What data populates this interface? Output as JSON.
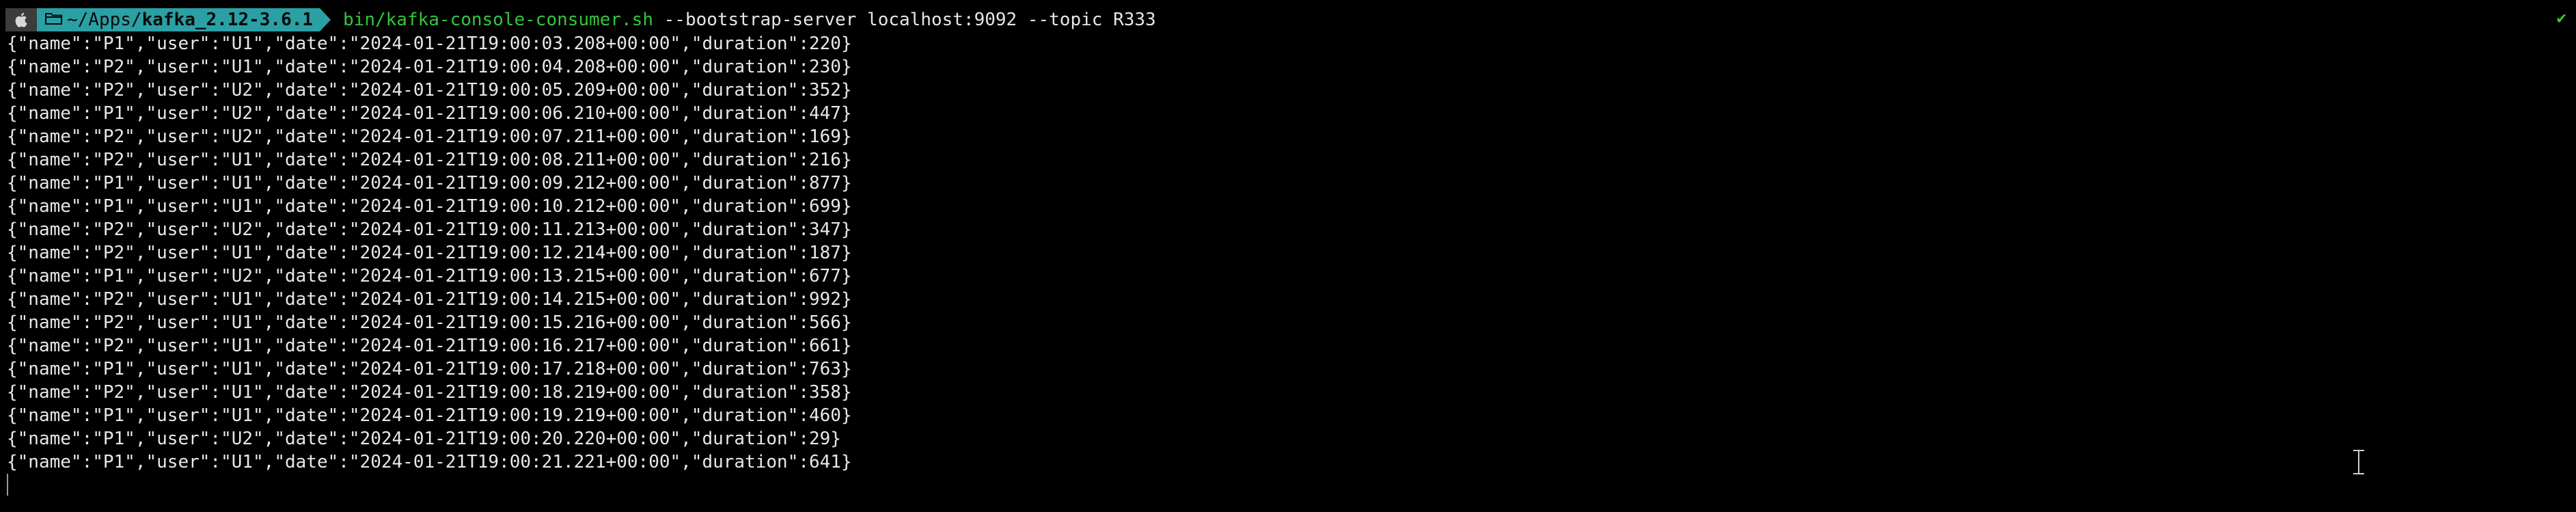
{
  "prompt": {
    "os_icon": "apple-icon",
    "folder_icon": "folder-icon",
    "path_prefix": "~/Apps/",
    "path_current": "kafka_2.12-3.6.1",
    "command_exe": "bin/kafka-console-consumer.sh",
    "command_args": " --bootstrap-server localhost:9092 --topic R333",
    "status_mark": "✔"
  },
  "output": {
    "lines": [
      "{\"name\":\"P1\",\"user\":\"U1\",\"date\":\"2024-01-21T19:00:03.208+00:00\",\"duration\":220}",
      "{\"name\":\"P2\",\"user\":\"U1\",\"date\":\"2024-01-21T19:00:04.208+00:00\",\"duration\":230}",
      "{\"name\":\"P2\",\"user\":\"U2\",\"date\":\"2024-01-21T19:00:05.209+00:00\",\"duration\":352}",
      "{\"name\":\"P1\",\"user\":\"U2\",\"date\":\"2024-01-21T19:00:06.210+00:00\",\"duration\":447}",
      "{\"name\":\"P2\",\"user\":\"U2\",\"date\":\"2024-01-21T19:00:07.211+00:00\",\"duration\":169}",
      "{\"name\":\"P2\",\"user\":\"U1\",\"date\":\"2024-01-21T19:00:08.211+00:00\",\"duration\":216}",
      "{\"name\":\"P1\",\"user\":\"U1\",\"date\":\"2024-01-21T19:00:09.212+00:00\",\"duration\":877}",
      "{\"name\":\"P1\",\"user\":\"U1\",\"date\":\"2024-01-21T19:00:10.212+00:00\",\"duration\":699}",
      "{\"name\":\"P2\",\"user\":\"U2\",\"date\":\"2024-01-21T19:00:11.213+00:00\",\"duration\":347}",
      "{\"name\":\"P2\",\"user\":\"U1\",\"date\":\"2024-01-21T19:00:12.214+00:00\",\"duration\":187}",
      "{\"name\":\"P1\",\"user\":\"U2\",\"date\":\"2024-01-21T19:00:13.215+00:00\",\"duration\":677}",
      "{\"name\":\"P2\",\"user\":\"U1\",\"date\":\"2024-01-21T19:00:14.215+00:00\",\"duration\":992}",
      "{\"name\":\"P2\",\"user\":\"U1\",\"date\":\"2024-01-21T19:00:15.216+00:00\",\"duration\":566}",
      "{\"name\":\"P2\",\"user\":\"U1\",\"date\":\"2024-01-21T19:00:16.217+00:00\",\"duration\":661}",
      "{\"name\":\"P1\",\"user\":\"U1\",\"date\":\"2024-01-21T19:00:17.218+00:00\",\"duration\":763}",
      "{\"name\":\"P2\",\"user\":\"U1\",\"date\":\"2024-01-21T19:00:18.219+00:00\",\"duration\":358}",
      "{\"name\":\"P1\",\"user\":\"U1\",\"date\":\"2024-01-21T19:00:19.219+00:00\",\"duration\":460}",
      "{\"name\":\"P1\",\"user\":\"U2\",\"date\":\"2024-01-21T19:00:20.220+00:00\",\"duration\":29}",
      "{\"name\":\"P1\",\"user\":\"U1\",\"date\":\"2024-01-21T19:00:21.221+00:00\",\"duration\":641}"
    ]
  },
  "colors": {
    "background": "#000000",
    "path_segment": "#2aa0a4",
    "icon_segment": "#3c3c3c",
    "executable": "#35c43e",
    "text": "#e6e6e6"
  }
}
